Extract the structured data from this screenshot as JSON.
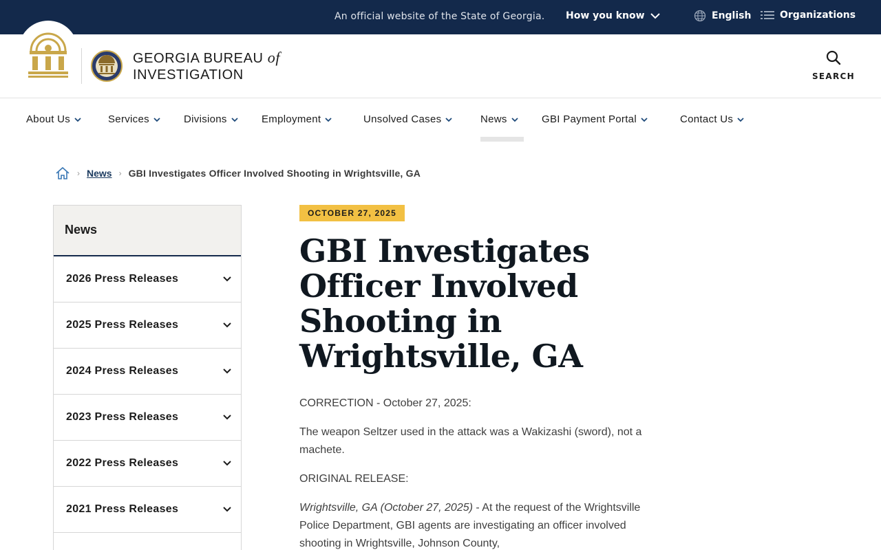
{
  "topbar": {
    "official_text": "An official website of the State of Georgia.",
    "how_you_know": "How you know",
    "language": "English",
    "organizations": "Organizations"
  },
  "header": {
    "agency_line1": "GEORGIA BUREAU",
    "agency_of": "of",
    "agency_line2": "INVESTIGATION",
    "search_label": "SEARCH"
  },
  "nav": {
    "items": [
      {
        "label": "About Us"
      },
      {
        "label": "Services"
      },
      {
        "label": "Divisions"
      },
      {
        "label": "Employment"
      },
      {
        "label": "Unsolved Cases"
      },
      {
        "label": "News"
      },
      {
        "label": "GBI Payment Portal"
      },
      {
        "label": "Contact Us"
      }
    ],
    "active": "News"
  },
  "breadcrumb": {
    "link": "News",
    "current": "GBI Investigates Officer Involved Shooting in Wrightsville, GA"
  },
  "sidebar": {
    "title": "News",
    "items": [
      {
        "label": "2026 Press Releases"
      },
      {
        "label": "2025 Press Releases"
      },
      {
        "label": "2024 Press Releases"
      },
      {
        "label": "2023 Press Releases"
      },
      {
        "label": "2022 Press Releases"
      },
      {
        "label": "2021 Press Releases"
      }
    ]
  },
  "article": {
    "date": "OCTOBER 27, 2025",
    "title": "GBI Investigates Officer Involved Shooting in Wrightsville, GA",
    "correction": "CORRECTION - October 27, 2025:",
    "correction_body": "The weapon Seltzer used in the attack was a Wakizashi (sword), not a machete.",
    "original_label": "ORIGINAL RELEASE:",
    "dateline": "Wrightsville, GA (October 27, 2025)",
    "lead": " - At the request of the Wrightsville Police Department, GBI agents are investigating an officer involved shooting in Wrightsville, Johnson County,"
  },
  "colors": {
    "topbar_bg": "#13294b",
    "badge": "#f2c043",
    "seal_gold": "#c9a74a"
  }
}
